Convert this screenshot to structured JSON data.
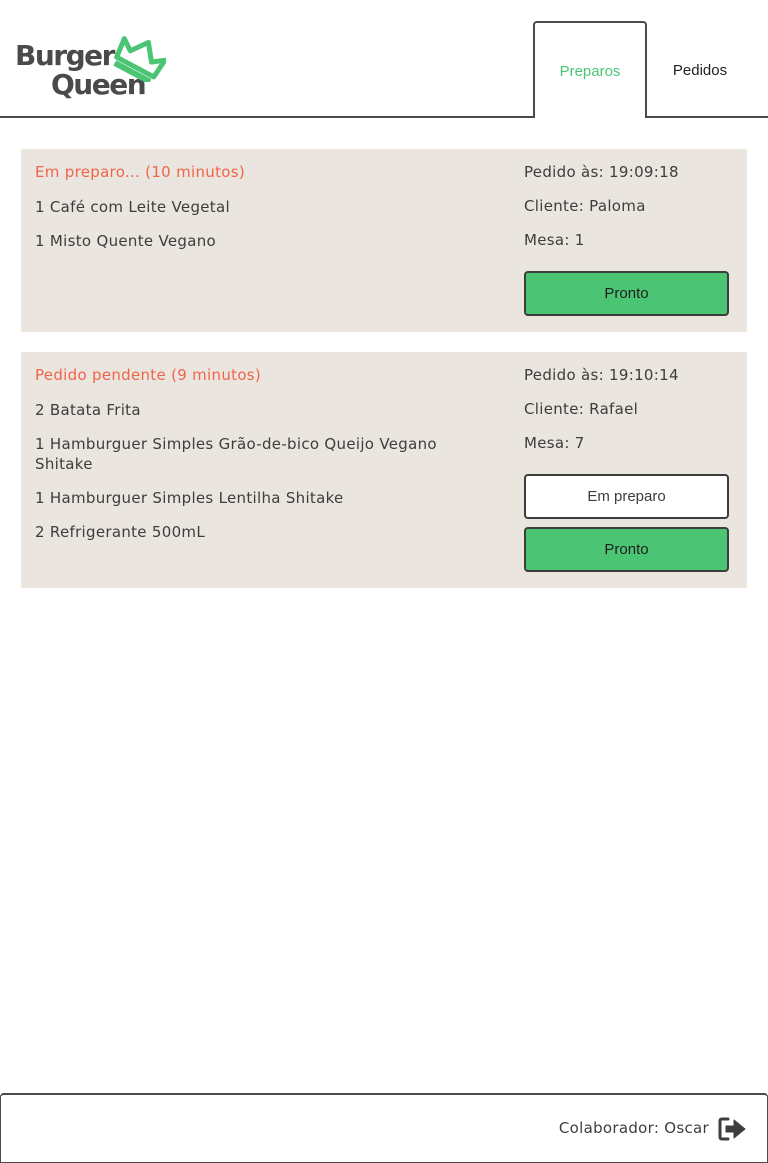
{
  "brand": {
    "word1": "Burger",
    "word2": "Queen",
    "accent_color": "#4bc574",
    "dark_color": "#4a4a4a"
  },
  "tabs": [
    {
      "label": "Preparos",
      "active": true
    },
    {
      "label": "Pedidos",
      "active": false
    }
  ],
  "orders": [
    {
      "status": "Em preparo... (10 minutos)",
      "items": [
        "1 Café com Leite Vegetal",
        "1 Misto Quente Vegano"
      ],
      "ordered_at": "Pedido às: 19:09:18",
      "client": "Cliente: Paloma",
      "table": "Mesa: 1",
      "buttons": {
        "ready": "Pronto"
      }
    },
    {
      "status": "Pedido pendente (9 minutos)",
      "items": [
        "2 Batata Frita",
        "1 Hamburguer Simples Grão-de-bico Queijo Vegano Shitake",
        "1 Hamburguer Simples Lentilha Shitake",
        "2 Refrigerante 500mL"
      ],
      "ordered_at": "Pedido às: 19:10:14",
      "client": "Cliente: Rafael",
      "table": "Mesa: 7",
      "buttons": {
        "in_progress": "Em preparo",
        "ready": "Pronto"
      }
    }
  ],
  "footer": {
    "collaborator": "Colaborador: Oscar",
    "logout_icon": "sign-out-icon"
  },
  "colors": {
    "status": "#f0654a",
    "card_bg": "#ebe5df",
    "ready_button": "#4bc574"
  }
}
